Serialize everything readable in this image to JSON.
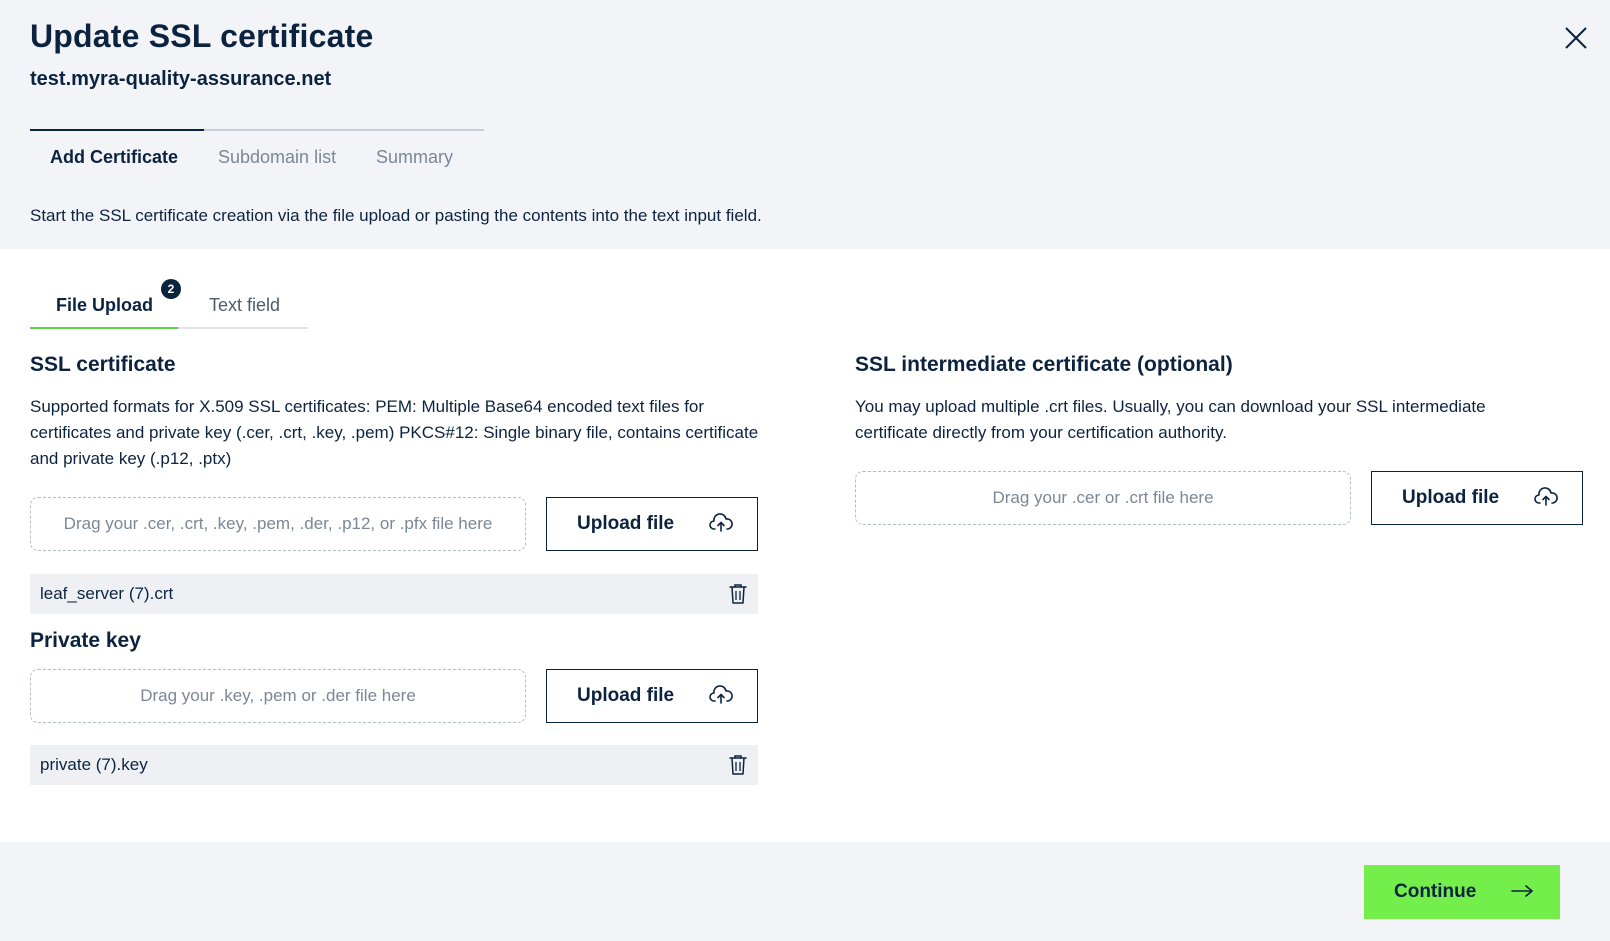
{
  "dialog": {
    "title": "Update SSL certificate",
    "subtitle": "test.myra-quality-assurance.net",
    "close_icon": "close-icon"
  },
  "steps": [
    {
      "label": "Add Certificate",
      "active": true
    },
    {
      "label": "Subdomain list",
      "active": false
    },
    {
      "label": "Summary",
      "active": false
    }
  ],
  "intro": "Start the SSL certificate creation via the file upload or pasting the contents into the text input field.",
  "tabs": [
    {
      "label": "File Upload",
      "active": true,
      "badge": "2"
    },
    {
      "label": "Text field",
      "active": false
    }
  ],
  "ssl_certificate": {
    "title": "SSL certificate",
    "description": "Supported formats for X.509 SSL certificates: PEM: Multiple Base64 encoded text files for certificates and private key (.cer, .crt, .key, .pem) PKCS#12: Single binary file, contains certificate and private key (.p12, .ptx)",
    "dropzone": "Drag your .cer, .crt, .key, .pem, .der, .p12, or .pfx file here",
    "upload_label": "Upload file",
    "file_name": "leaf_server (7).crt"
  },
  "private_key": {
    "title": "Private key",
    "dropzone": "Drag your .key, .pem or .der file here",
    "upload_label": "Upload file",
    "file_name": "private (7).key"
  },
  "intermediate": {
    "title": "SSL intermediate certificate (optional)",
    "description": "You may upload multiple .crt files. Usually, you can download your SSL intermediate certificate directly from your certification authority.",
    "dropzone": "Drag your .cer or .crt file here",
    "upload_label": "Upload file"
  },
  "footer": {
    "continue_label": "Continue"
  },
  "colors": {
    "primary": "#0c2340",
    "accent": "#74ee4a",
    "tab_underline": "#5fd14a",
    "background": "#f2f4f8"
  }
}
